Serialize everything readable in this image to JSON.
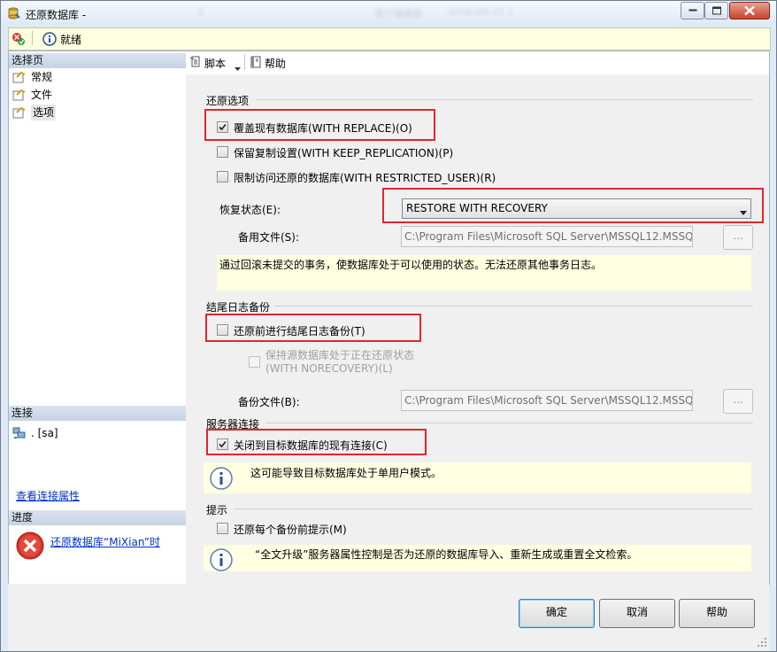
{
  "window": {
    "title": "还原数据库 -",
    "blurred_title": [
      "3",
      "客户端更新",
      "2016-05-15 1"
    ]
  },
  "status": {
    "text": "就绪"
  },
  "left": {
    "select_page_header": "选择页",
    "pages": [
      {
        "label": "常规"
      },
      {
        "label": "文件"
      },
      {
        "label": "选项"
      }
    ],
    "connection_header": "连接",
    "connection_value": ". [sa]",
    "view_connection_link": "查看连接属性",
    "progress_header": "进度",
    "progress_link": "还原数据库“MiXian”时"
  },
  "toolbar": {
    "script": "脚本",
    "help": "帮助"
  },
  "restore_options": {
    "group_title": "还原选项",
    "overwrite": {
      "label": "覆盖现有数据库(WITH REPLACE)(O)",
      "checked": true
    },
    "keep_replication": {
      "label": "保留复制设置(WITH KEEP_REPLICATION)(P)",
      "checked": false
    },
    "restrict_user": {
      "label": "限制访问还原的数据库(WITH RESTRICTED_USER)(R)",
      "checked": false
    },
    "recovery_state_label": "恢复状态(E):",
    "recovery_state_value": "RESTORE WITH RECOVERY",
    "standby_file_label": "备用文件(S):",
    "standby_file_value": "C:\\Program Files\\Microsoft SQL Server\\MSSQL12.MSSQ",
    "browse": "...",
    "note": "通过回滚未提交的事务，使数据库处于可以使用的状态。无法还原其他事务日志。"
  },
  "tail_log": {
    "group_title": "结尾日志备份",
    "take_tail": {
      "label": "还原前进行结尾日志备份(T)",
      "checked": false
    },
    "norecovery_line1": "保持源数据库处于正在还原状态",
    "norecovery_line2": "(WITH NORECOVERY)(L)",
    "backup_file_label": "备份文件(B):",
    "backup_file_value": "C:\\Program Files\\Microsoft SQL Server\\MSSQL12.MSSQ",
    "browse": "..."
  },
  "server_connections": {
    "group_title": "服务器连接",
    "close_existing": {
      "label": "关闭到目标数据库的现有连接(C)",
      "checked": true
    },
    "note": "这可能导致目标数据库处于单用户模式。"
  },
  "prompt": {
    "group_title": "提示",
    "prompt_each": {
      "label": "还原每个备份前提示(M)",
      "checked": false
    },
    "note": "“全文升级”服务器属性控制是否为还原的数据库导入、重新生成或重置全文检索。"
  },
  "buttons": {
    "ok": "确定",
    "cancel": "取消",
    "help": "帮助"
  },
  "colors": {
    "highlight_box": "#e0262c",
    "note_bg": "#ffffe1",
    "link": "#0033cc"
  }
}
